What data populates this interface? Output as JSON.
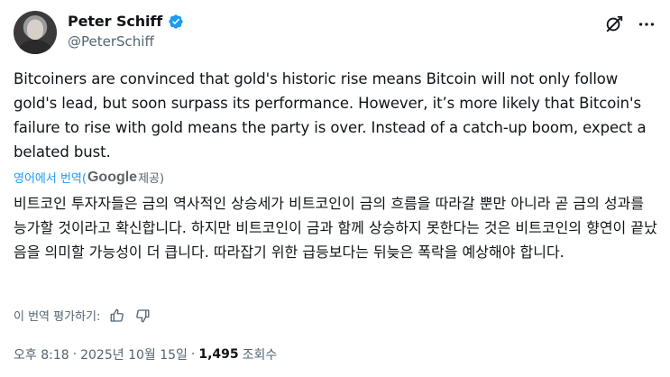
{
  "author": {
    "display_name": "Peter Schiff",
    "handle": "@PeterSchiff",
    "verified_color": "#1d9bf0"
  },
  "header_icons": [
    "grok-icon",
    "more-icon"
  ],
  "tweet": {
    "text": "Bitcoiners are convinced that gold's historic rise means Bitcoin will not only follow gold's lead, but soon surpass its performance. However, it’s more likely that Bitcoin's failure to rise with gold means the party is over. Instead of a catch-up boom, expect a belated bust."
  },
  "translation": {
    "label_prefix": "영어에서 번역(",
    "provider": "Google",
    "label_suffix": "제공)",
    "text": "비트코인 투자자들은 금의 역사적인 상승세가 비트코인이 금의 흐름을 따라갈 뿐만 아니라 곧 금의 성과를 능가할 것이라고 확신합니다. 하지만 비트코인이 금과 함께 상승하지 못한다는 것은 비트코인의 향연이 끝났음을 의미할 가능성이 더 큽니다. 따라잡기 위한 급등보다는 뒤늦은 폭락을 예상해야 합니다.",
    "rate_label": "이 번역 평가하기:"
  },
  "meta": {
    "time": "오후 8:18",
    "sep1": "·",
    "date": "2025년 10월 15일",
    "sep2": "·",
    "views_count": "1,495",
    "views_label": "조회수"
  }
}
